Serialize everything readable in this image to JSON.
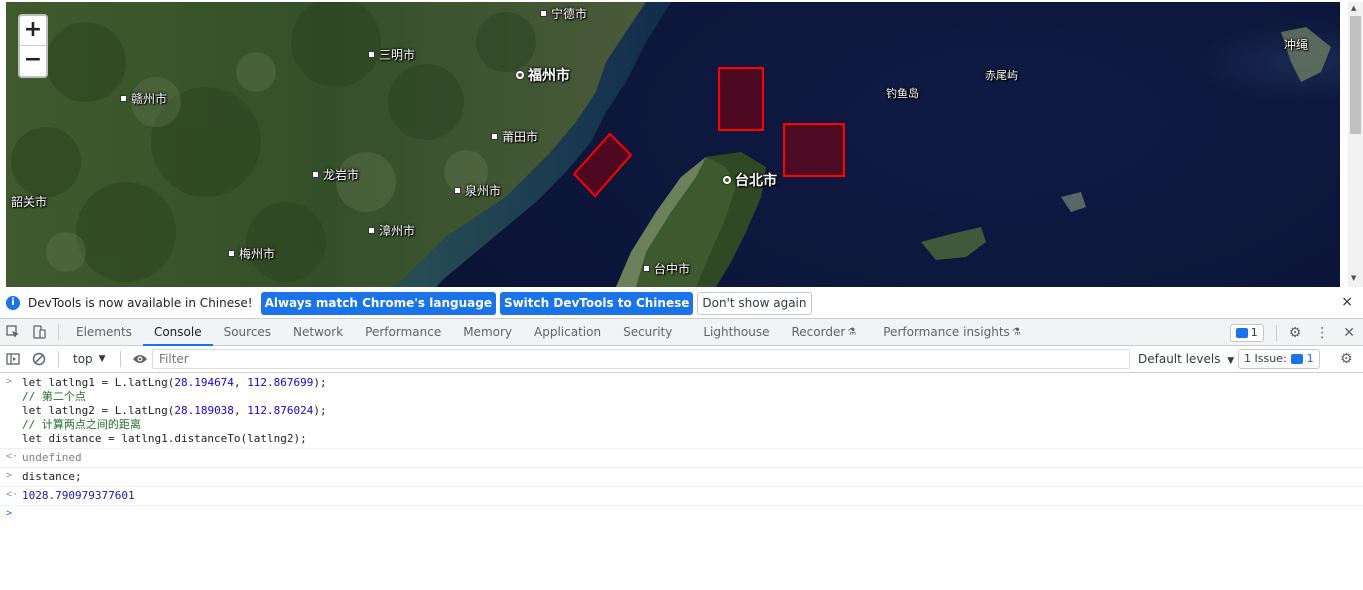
{
  "map": {
    "zoom_in": "+",
    "zoom_out": "−",
    "places": {
      "ningde": "宁德市",
      "sanming": "三明市",
      "fuzhou": "福州市",
      "ganzhou": "赣州市",
      "putian": "莆田市",
      "longyan": "龙岩市",
      "quanzhou": "泉州市",
      "shaoguan": "韶关市",
      "zhangzhou": "漳州市",
      "meizhou": "梅州市",
      "taibei": "台北市",
      "taizhong": "台中市",
      "diaoyudao": "钓鱼岛",
      "chiweiyu": "赤尾屿",
      "chongsheng": "冲绳"
    }
  },
  "infobar": {
    "message": "DevTools is now available in Chinese!",
    "btn_match": "Always match Chrome's language",
    "btn_switch": "Switch DevTools to Chinese",
    "btn_dont_show": "Don't show again",
    "close": "×"
  },
  "tabs": [
    "Elements",
    "Console",
    "Sources",
    "Network",
    "Performance",
    "Memory",
    "Application",
    "Security",
    "Lighthouse",
    "Recorder",
    "Performance insights"
  ],
  "active_tab": "Console",
  "issues_count": "1",
  "console_toolbar": {
    "context": "top",
    "filter_placeholder": "Filter",
    "levels": "Default levels",
    "issues_label": "1 Issue:",
    "issues_count": "1"
  },
  "console": {
    "entry1": {
      "l1_pre": "let latlng1 = L.latLng(",
      "l1_a": "28.194674",
      "l1_sep": ", ",
      "l1_b": "112.867699",
      "l1_post": ");",
      "l2": "// 第二个点",
      "l3_pre": "let latlng2 = L.latLng(",
      "l3_a": "28.189038",
      "l3_sep": ", ",
      "l3_b": "112.876024",
      "l3_post": ");",
      "l4": "// 计算两点之间的距离",
      "l5": "let distance = latlng1.distanceTo(latlng2);"
    },
    "result1": "undefined",
    "entry2": "distance;",
    "result2": "1028.790979377601"
  },
  "colors": {
    "accent": "#1a73e8",
    "polygon_stroke": "#ff0000",
    "polygon_fill": "#7a0010"
  }
}
